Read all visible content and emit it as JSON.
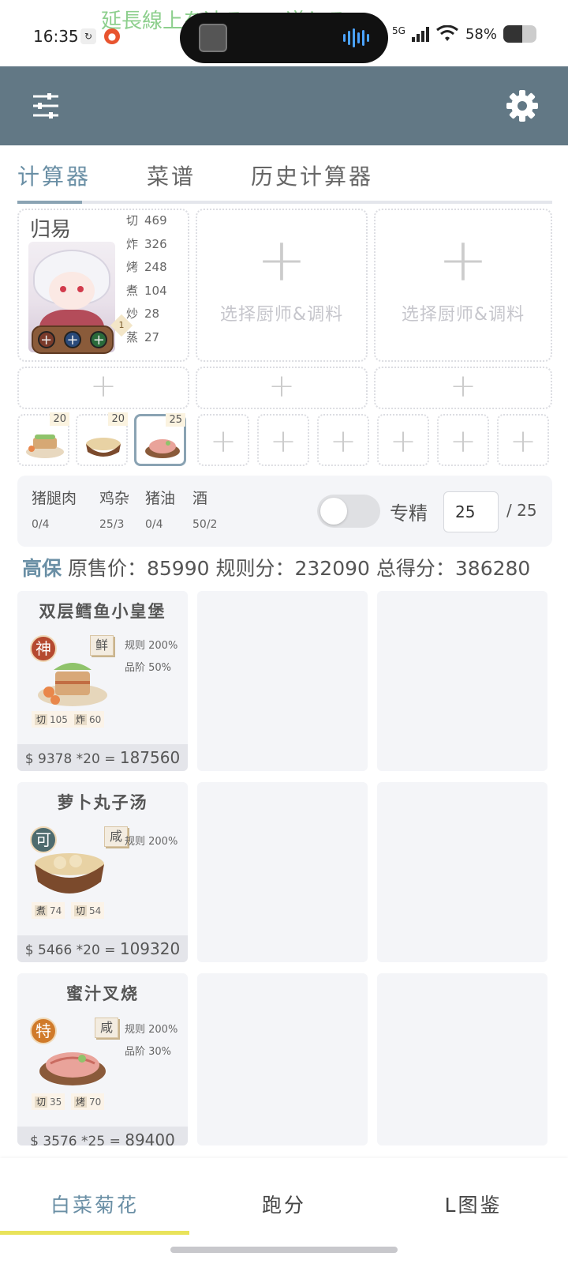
{
  "status": {
    "time": "16:35",
    "marquee": "延長線上を辿るこの道しるべ",
    "network": "5G",
    "battery": "58%"
  },
  "appbar": {
    "menu_icon": "sliders-icon",
    "settings_icon": "gear-icon",
    "color": "#627885"
  },
  "tabs": [
    {
      "label": "计算器",
      "active": true
    },
    {
      "label": "菜谱",
      "active": false
    },
    {
      "label": "历史计算器",
      "active": false
    }
  ],
  "chefs": [
    {
      "name": "归易",
      "level": "1",
      "skills": [
        {
          "k": "切",
          "v": "469"
        },
        {
          "k": "炸",
          "v": "326"
        },
        {
          "k": "烤",
          "v": "248"
        },
        {
          "k": "煮",
          "v": "104"
        },
        {
          "k": "炒",
          "v": "28"
        },
        {
          "k": "蒸",
          "v": "27"
        }
      ]
    },
    {
      "pick_label": "选择厨师&调料"
    },
    {
      "pick_label": "选择厨师&调料"
    }
  ],
  "recipe_slots": [
    {
      "count": "20"
    },
    {
      "count": "20"
    },
    {
      "count": "25"
    }
  ],
  "materials": [
    {
      "name": "猪腿肉",
      "value": "0/4"
    },
    {
      "name": "鸡杂",
      "value": "25/3"
    },
    {
      "name": "猪油",
      "value": "0/4"
    },
    {
      "name": "酒",
      "value": "50/2"
    }
  ],
  "specialty": {
    "label": "专精",
    "value": "25",
    "max": "/ 25",
    "enabled": false
  },
  "score": {
    "rank": "高保",
    "orig_label": "原售价：",
    "orig_value": "85990",
    "rule_label": "规则分：",
    "rule_value": "232090",
    "total_label": "总得分：",
    "total_value": "386280"
  },
  "recipes": [
    {
      "title": "双层鳕鱼小皇堡",
      "grade": "神",
      "grade_color": "#b5492f",
      "flavor": "鲜",
      "bonus": [
        "规则 200%",
        "品阶 50%"
      ],
      "tags": [
        {
          "k": "切",
          "v": "105"
        },
        {
          "k": "炸",
          "v": "60"
        }
      ],
      "price_prefix": "$ 9378 *20 = ",
      "price_total": "187560"
    },
    {
      "title": "萝卜丸子汤",
      "grade": "可",
      "grade_color": "#4e6b6e",
      "flavor": "咸",
      "bonus": [
        "规则 200%"
      ],
      "tags": [
        {
          "k": "煮",
          "v": "74"
        },
        {
          "k": "切",
          "v": "54"
        }
      ],
      "price_prefix": "$ 5466 *20 = ",
      "price_total": "109320"
    },
    {
      "title": "蜜汁叉烧",
      "grade": "特",
      "grade_color": "#d07a2a",
      "flavor": "咸",
      "bonus": [
        "规则 200%",
        "品阶 30%"
      ],
      "tags": [
        {
          "k": "切",
          "v": "35"
        },
        {
          "k": "烤",
          "v": "70"
        }
      ],
      "price_prefix": "$ 3576 *25 = ",
      "price_total": "89400"
    }
  ],
  "bottom_nav": [
    {
      "label": "白菜菊花",
      "active": true
    },
    {
      "label": "跑分",
      "active": false
    },
    {
      "label": "L图鉴",
      "active": false
    }
  ]
}
